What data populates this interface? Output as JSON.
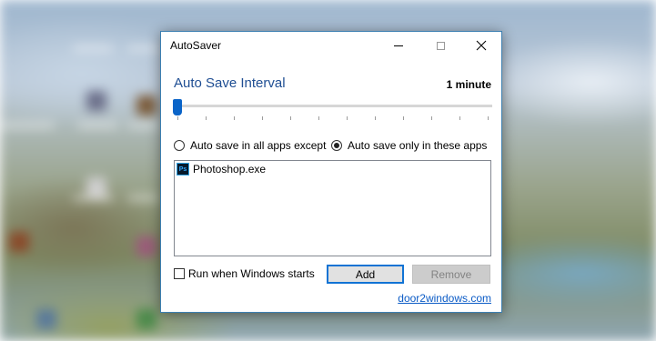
{
  "window": {
    "title": "AutoSaver"
  },
  "interval": {
    "heading": "Auto Save Interval",
    "value": "1 minute",
    "slider_position": 0
  },
  "mode": {
    "option_all_except": "Auto save in all apps except",
    "option_only_these": "Auto save only in these apps",
    "selected": "option_only_these"
  },
  "apps": [
    {
      "name": "Photoshop.exe",
      "icon": "photoshop-icon",
      "icon_text": "Ps"
    }
  ],
  "startup": {
    "label": "Run when Windows starts",
    "checked": false
  },
  "buttons": {
    "add": "Add",
    "remove": "Remove"
  },
  "footer": {
    "link": "door2windows.com"
  },
  "colors": {
    "accent": "#1f4e93",
    "slider": "#0a64c8",
    "link": "#0b5bc6"
  }
}
